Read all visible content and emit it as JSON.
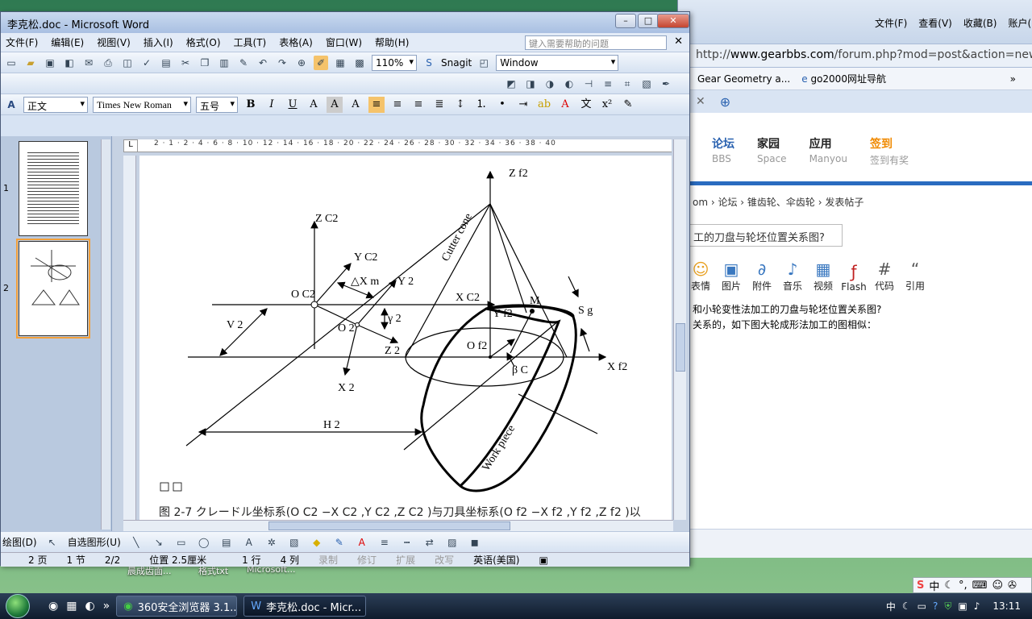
{
  "desktop": {
    "labels": [
      "晨成齿面...",
      "格式txt",
      "Microsoft..."
    ]
  },
  "browser": {
    "menu": [
      "文件(F)",
      "查看(V)",
      "收藏(B)",
      "账户("
    ],
    "url_prefix": "http://",
    "url_domain": "www.gearbbs.com",
    "url_rest": "/forum.php?mod=post&action=newth",
    "favorites": [
      "Gear Geometry a...",
      "go2000网址导航"
    ],
    "nav": [
      {
        "main": "论坛",
        "sub": "BBS"
      },
      {
        "main": "家园",
        "sub": "Space"
      },
      {
        "main": "应用",
        "sub": "Manyou"
      },
      {
        "main": "签到",
        "sub": "签到有奖"
      }
    ],
    "breadcrumb": [
      "om",
      "论坛",
      "锥齿轮、伞齿轮",
      "发表帖子"
    ],
    "post_title": "工的刀盘与轮坯位置关系图?",
    "editor_tools": [
      "表情",
      "图片",
      "附件",
      "音乐",
      "视频",
      "Flash",
      "代码",
      "引用"
    ],
    "body_lines": [
      "和小轮变性法加工的刀盘与轮坯位置关系图?",
      "关系的，如下图大轮成形法加工的图相似："
    ]
  },
  "word": {
    "title": "李克松.doc - Microsoft Word",
    "menu": [
      "文件(F)",
      "编辑(E)",
      "视图(V)",
      "插入(I)",
      "格式(O)",
      "工具(T)",
      "表格(A)",
      "窗口(W)",
      "帮助(H)"
    ],
    "help_placeholder": "键入需要帮助的问题",
    "zoom": "110%",
    "snagit": "Snagit",
    "snagit_target": "Window",
    "style": "正文",
    "font": "Times New Roman",
    "size": "五号",
    "thumb_numbers": [
      "1",
      "2"
    ],
    "draw_menu": "绘图(D)",
    "autoshape_menu": "自选图形(U)",
    "status": {
      "page": "2 页",
      "section": "1 节",
      "pages": "2/2",
      "position": "位置 2.5厘米",
      "line": "1 行",
      "col": "4 列",
      "rec": "录制",
      "trk": "修订",
      "ext": "扩展",
      "ovr": "改写",
      "lang": "英语(美国)"
    },
    "figure": {
      "labels": {
        "zf2": "Z f2",
        "zc2": "Z C2",
        "yc2": "Y C2",
        "y2": "Y 2",
        "dxm": "△X m",
        "oc2": "O C2",
        "xc2": "X C2",
        "m": "M",
        "sg": "S g",
        "yf2": "Y f2",
        "v2": "V 2",
        "gamma2": "γ 2",
        "o2": "O 2",
        "of2": "O f2",
        "z2": "Z 2",
        "xf2": "X f2",
        "betac": "β C",
        "x2": "X 2",
        "h2": "H 2",
        "cutter_cone": "Cutter cone",
        "work_piece": "Work piece"
      },
      "caption": "图 2-7 クレードル坐标系(O C2 −X C2 ,Y C2 ,Z C2 )与刀具坐标系(O f2 −X f2 ,Y f2 ,Z f2 )以"
    }
  },
  "taskbar": {
    "tasks": [
      "360安全浏览器 3.1...",
      "李克松.doc - Micr..."
    ],
    "clock": "13:11",
    "ime": "中"
  }
}
